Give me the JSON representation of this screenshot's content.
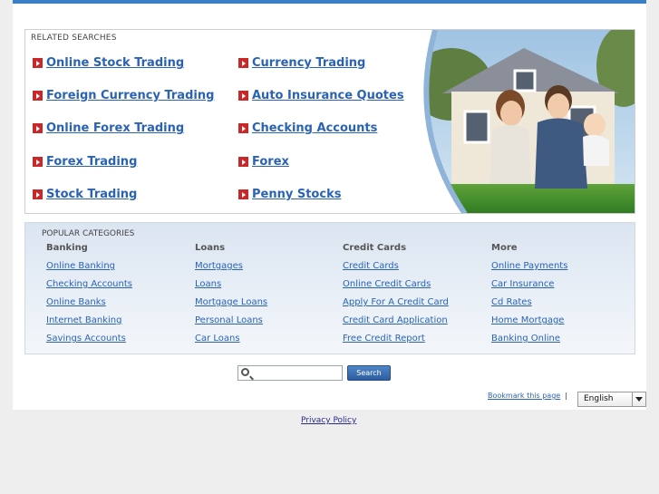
{
  "related": {
    "title": "RELATED SEARCHES",
    "left": [
      "Online Stock Trading",
      "Foreign Currency Trading",
      "Online Forex Trading",
      "Forex Trading",
      "Stock Trading"
    ],
    "right": [
      "Currency Trading",
      "Auto Insurance Quotes",
      "Checking Accounts",
      "Forex",
      "Penny Stocks"
    ]
  },
  "popular": {
    "title": "POPULAR CATEGORIES",
    "columns": [
      {
        "heading": "Banking",
        "links": [
          "Online Banking",
          "Checking Accounts",
          "Online Banks",
          "Internet Banking",
          "Savings Accounts"
        ]
      },
      {
        "heading": "Loans",
        "links": [
          "Mortgages",
          "Loans",
          "Mortgage Loans",
          "Personal Loans",
          "Car Loans"
        ]
      },
      {
        "heading": "Credit Cards",
        "links": [
          "Credit Cards",
          "Online Credit Cards",
          "Apply For A Credit Card",
          "Credit Card Application",
          "Free Credit Report"
        ]
      },
      {
        "heading": "More",
        "links": [
          "Online Payments",
          "Car Insurance",
          "Cd Rates",
          "Home Mortgage",
          "Banking Online"
        ]
      }
    ]
  },
  "search": {
    "button_label": "Search",
    "value": ""
  },
  "footer": {
    "bookmark": "Bookmark this page",
    "separator": "|",
    "language": "English",
    "privacy": "Privacy Policy"
  },
  "colors": {
    "accent": "#3a7fc6",
    "link": "#2a63b4",
    "arrow": "#c8282a"
  }
}
